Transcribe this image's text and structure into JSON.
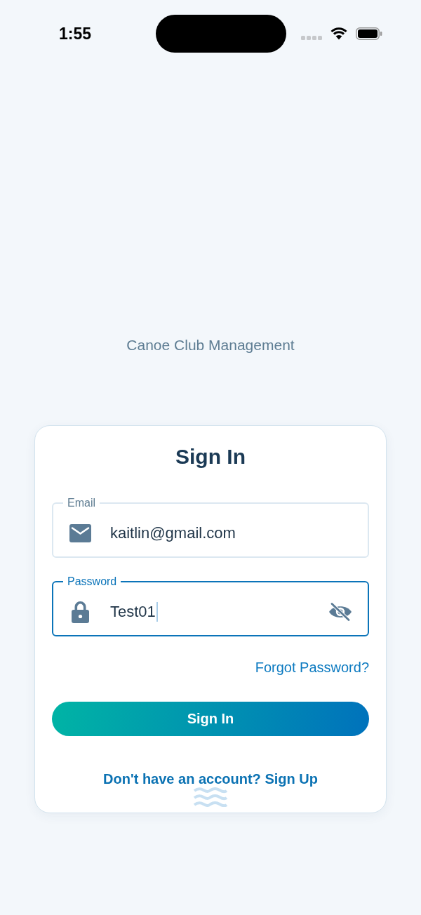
{
  "status_bar": {
    "time": "1:55"
  },
  "app": {
    "subtitle": "Canoe Club Management"
  },
  "card": {
    "title": "Sign In",
    "fields": [
      {
        "kind": "email",
        "label": "Email",
        "value": "kaitlin@gmail.com",
        "focused": false
      },
      {
        "kind": "password",
        "label": "Password",
        "value": "Test01",
        "focused": true,
        "visible": true
      }
    ],
    "forgot_link": "Forgot Password?",
    "submit_button": "Sign In",
    "signup_link": "Don't have an account? Sign Up"
  }
}
